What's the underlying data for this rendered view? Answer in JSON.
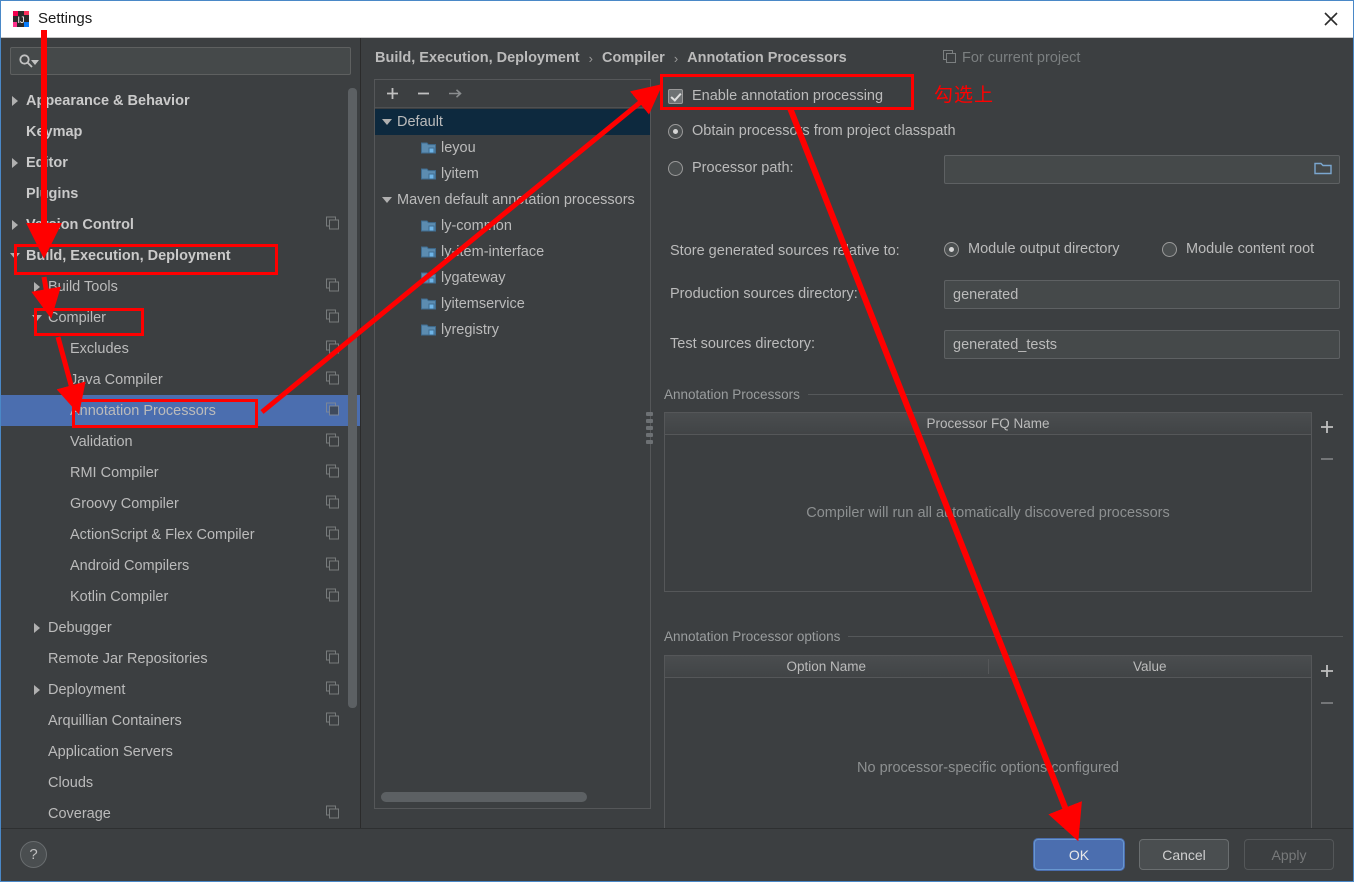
{
  "window": {
    "title": "Settings",
    "logo_icon": "intellij-idea-logo",
    "close_icon": "close-icon",
    "accent_color": "#4b6eaf",
    "annotation_color": "#ff0000"
  },
  "search": {
    "value": "",
    "placeholder": "",
    "icon": "search-icon",
    "dropdown_icon": "chevron-down-icon"
  },
  "sidebar": {
    "items": [
      {
        "label": "Appearance & Behavior",
        "twisty": "collapsed",
        "indent": 0,
        "bold": true,
        "copy": false,
        "selected": false
      },
      {
        "label": "Keymap",
        "twisty": "none",
        "indent": 0,
        "bold": true,
        "copy": false,
        "selected": false
      },
      {
        "label": "Editor",
        "twisty": "collapsed",
        "indent": 0,
        "bold": true,
        "copy": false,
        "selected": false
      },
      {
        "label": "Plugins",
        "twisty": "none",
        "indent": 0,
        "bold": true,
        "copy": false,
        "selected": false
      },
      {
        "label": "Version Control",
        "twisty": "collapsed",
        "indent": 0,
        "bold": true,
        "copy": true,
        "selected": false
      },
      {
        "label": "Build, Execution, Deployment",
        "twisty": "expanded",
        "indent": 0,
        "bold": true,
        "copy": false,
        "selected": false
      },
      {
        "label": "Build Tools",
        "twisty": "collapsed",
        "indent": 1,
        "bold": false,
        "copy": true,
        "selected": false
      },
      {
        "label": "Compiler",
        "twisty": "expanded",
        "indent": 1,
        "bold": false,
        "copy": true,
        "selected": false
      },
      {
        "label": "Excludes",
        "twisty": "none",
        "indent": 2,
        "bold": false,
        "copy": true,
        "selected": false
      },
      {
        "label": "Java Compiler",
        "twisty": "none",
        "indent": 2,
        "bold": false,
        "copy": true,
        "selected": false
      },
      {
        "label": "Annotation Processors",
        "twisty": "none",
        "indent": 2,
        "bold": false,
        "copy": true,
        "selected": true
      },
      {
        "label": "Validation",
        "twisty": "none",
        "indent": 2,
        "bold": false,
        "copy": true,
        "selected": false
      },
      {
        "label": "RMI Compiler",
        "twisty": "none",
        "indent": 2,
        "bold": false,
        "copy": true,
        "selected": false
      },
      {
        "label": "Groovy Compiler",
        "twisty": "none",
        "indent": 2,
        "bold": false,
        "copy": true,
        "selected": false
      },
      {
        "label": "ActionScript & Flex Compiler",
        "twisty": "none",
        "indent": 2,
        "bold": false,
        "copy": true,
        "selected": false
      },
      {
        "label": "Android Compilers",
        "twisty": "none",
        "indent": 2,
        "bold": false,
        "copy": true,
        "selected": false
      },
      {
        "label": "Kotlin Compiler",
        "twisty": "none",
        "indent": 2,
        "bold": false,
        "copy": true,
        "selected": false
      },
      {
        "label": "Debugger",
        "twisty": "collapsed",
        "indent": 1,
        "bold": false,
        "copy": false,
        "selected": false
      },
      {
        "label": "Remote Jar Repositories",
        "twisty": "none",
        "indent": 1,
        "bold": false,
        "copy": true,
        "selected": false
      },
      {
        "label": "Deployment",
        "twisty": "collapsed",
        "indent": 1,
        "bold": false,
        "copy": true,
        "selected": false
      },
      {
        "label": "Arquillian Containers",
        "twisty": "none",
        "indent": 1,
        "bold": false,
        "copy": true,
        "selected": false
      },
      {
        "label": "Application Servers",
        "twisty": "none",
        "indent": 1,
        "bold": false,
        "copy": false,
        "selected": false
      },
      {
        "label": "Clouds",
        "twisty": "none",
        "indent": 1,
        "bold": false,
        "copy": false,
        "selected": false
      },
      {
        "label": "Coverage",
        "twisty": "none",
        "indent": 1,
        "bold": false,
        "copy": true,
        "selected": false
      }
    ]
  },
  "breadcrumb": {
    "parts": [
      "Build, Execution, Deployment",
      "Compiler",
      "Annotation Processors"
    ],
    "separator": "›",
    "scope_label": "For current project",
    "scope_icon": "copy-icon"
  },
  "modules_panel": {
    "toolbar": [
      {
        "icon": "plus-icon",
        "name": "add-profile-button"
      },
      {
        "icon": "minus-icon",
        "name": "remove-profile-button"
      },
      {
        "icon": "arrow-right-icon",
        "name": "move-to-profile-button"
      }
    ],
    "tree": [
      {
        "label": "Default",
        "type": "profile",
        "twisty": "expanded",
        "indent": 0,
        "selected": true
      },
      {
        "label": "leyou",
        "type": "module",
        "twisty": "none",
        "indent": 1,
        "selected": false
      },
      {
        "label": "lyitem",
        "type": "module",
        "twisty": "none",
        "indent": 1,
        "selected": false
      },
      {
        "label": "Maven default annotation processors",
        "type": "profile",
        "twisty": "expanded",
        "indent": 0,
        "selected": false
      },
      {
        "label": "ly-common",
        "type": "module",
        "twisty": "none",
        "indent": 1,
        "selected": false
      },
      {
        "label": "ly-item-interface",
        "type": "module",
        "twisty": "none",
        "indent": 1,
        "selected": false
      },
      {
        "label": "lygateway",
        "type": "module",
        "twisty": "none",
        "indent": 1,
        "selected": false
      },
      {
        "label": "lyitemservice",
        "type": "module",
        "twisty": "none",
        "indent": 1,
        "selected": false
      },
      {
        "label": "lyregistry",
        "type": "module",
        "twisty": "none",
        "indent": 1,
        "selected": false
      }
    ]
  },
  "form": {
    "enable_annotation_processing": {
      "label": "Enable annotation processing",
      "checked": true
    },
    "source_mode": {
      "options": [
        {
          "label": "Obtain processors from project classpath",
          "selected": true
        },
        {
          "label": "Processor path:",
          "selected": false
        }
      ],
      "processor_path_value": "",
      "folder_icon": "folder-icon"
    },
    "store_relative_label": "Store generated sources relative to:",
    "store_relative_options": [
      {
        "label": "Module output directory",
        "selected": true
      },
      {
        "label": "Module content root",
        "selected": false
      }
    ],
    "production_sources_label": "Production sources directory:",
    "production_sources_value": "generated",
    "test_sources_label": "Test sources directory:",
    "test_sources_value": "generated_tests",
    "processors_group": {
      "title": "Annotation Processors",
      "column": "Processor FQ Name",
      "empty_text": "Compiler will run all automatically discovered processors",
      "add_icon": "plus-icon",
      "remove_icon": "minus-icon"
    },
    "options_group": {
      "title": "Annotation Processor options",
      "columns": [
        "Option Name",
        "Value"
      ],
      "empty_text": "No processor-specific options configured",
      "add_icon": "plus-icon",
      "remove_icon": "minus-icon"
    }
  },
  "footer": {
    "help_label": "?",
    "ok_label": "OK",
    "cancel_label": "Cancel",
    "apply_label": "Apply",
    "apply_enabled": false
  },
  "annotations": {
    "handwritten_note": "勾选上"
  }
}
